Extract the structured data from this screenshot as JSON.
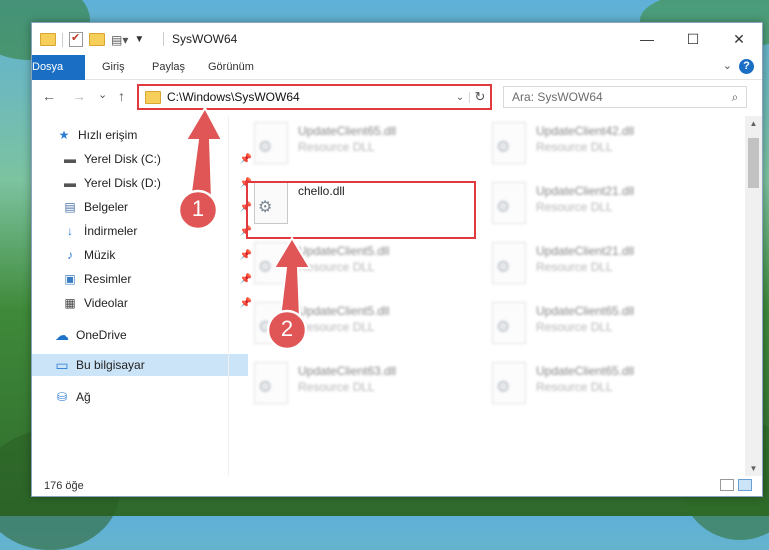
{
  "window": {
    "title": "SysWOW64",
    "controls": {
      "minimize": "—",
      "maximize": "☐",
      "close": "✕"
    }
  },
  "ribbon": {
    "tabs": [
      "Dosya",
      "Giriş",
      "Paylaş",
      "Görünüm"
    ],
    "help": "?"
  },
  "nav": {
    "back": "←",
    "forward": "→",
    "recent": "⌄",
    "up": "↑",
    "address": "C:\\Windows\\SysWOW64",
    "dropdown": "⌄",
    "refresh": "↻",
    "search_placeholder": "Ara: SysWOW64",
    "search_icon": "⌕"
  },
  "sidebar": {
    "items": [
      {
        "label": "Hızlı erişim",
        "icon": "star-icon",
        "glyph": "★",
        "color": "#2a7bd6",
        "pinned": false
      },
      {
        "label": "Yerel Disk (C:)",
        "icon": "drive-icon",
        "glyph": "▬",
        "color": "#555555",
        "pinned": true
      },
      {
        "label": "Yerel Disk (D:)",
        "icon": "drive-icon",
        "glyph": "▬",
        "color": "#555555",
        "pinned": true
      },
      {
        "label": "Belgeler",
        "icon": "document-icon",
        "glyph": "▤",
        "color": "#4a6fa5",
        "pinned": true
      },
      {
        "label": "İndirmeler",
        "icon": "download-icon",
        "glyph": "↓",
        "color": "#2a7bd6",
        "pinned": true
      },
      {
        "label": "Müzik",
        "icon": "music-icon",
        "glyph": "♪",
        "color": "#2a7bd6",
        "pinned": true
      },
      {
        "label": "Resimler",
        "icon": "pictures-icon",
        "glyph": "▣",
        "color": "#3a7cc4",
        "pinned": true
      },
      {
        "label": "Videolar",
        "icon": "video-icon",
        "glyph": "▦",
        "color": "#444444",
        "pinned": true
      },
      {
        "label": "OneDrive",
        "icon": "cloud-icon",
        "glyph": "☁",
        "color": "#1e73c9",
        "pinned": false
      },
      {
        "label": "Bu bilgisayar",
        "icon": "computer-icon",
        "glyph": "▭",
        "color": "#2a7bd6",
        "pinned": false,
        "selected": true
      },
      {
        "label": "Ağ",
        "icon": "network-icon",
        "glyph": "⛁",
        "color": "#2a7bd6",
        "pinned": false
      }
    ],
    "pin_glyph": "📌"
  },
  "files": [
    {
      "name": "UpdateClient65.dll",
      "desc": "Resource DLL",
      "blurred": true
    },
    {
      "name": "UpdateClient42.dll",
      "desc": "Resource DLL",
      "blurred": true
    },
    {
      "name": "chello.dll",
      "desc": "",
      "blurred": false,
      "highlighted": true
    },
    {
      "name": "UpdateClient21.dll",
      "desc": "Resource DLL",
      "blurred": true
    },
    {
      "name": "UpdateClient5.dll",
      "desc": "Resource DLL",
      "blurred": true
    },
    {
      "name": "UpdateClient21.dll",
      "desc": "Resource DLL",
      "blurred": true
    },
    {
      "name": "UpdateClient5.dll",
      "desc": "Resource DLL",
      "blurred": true
    },
    {
      "name": "UpdateClient65.dll",
      "desc": "Resource DLL",
      "blurred": true
    },
    {
      "name": "UpdateClient63.dll",
      "desc": "Resource DLL",
      "blurred": true
    },
    {
      "name": "UpdateClient65.dll",
      "desc": "Resource DLL",
      "blurred": true
    }
  ],
  "status": {
    "count": "176 öğe"
  },
  "annotations": [
    {
      "label": "1"
    },
    {
      "label": "2"
    }
  ],
  "colors": {
    "accent": "#1a6fc5",
    "highlight": "#e0393e",
    "selection": "#cce4f7"
  }
}
